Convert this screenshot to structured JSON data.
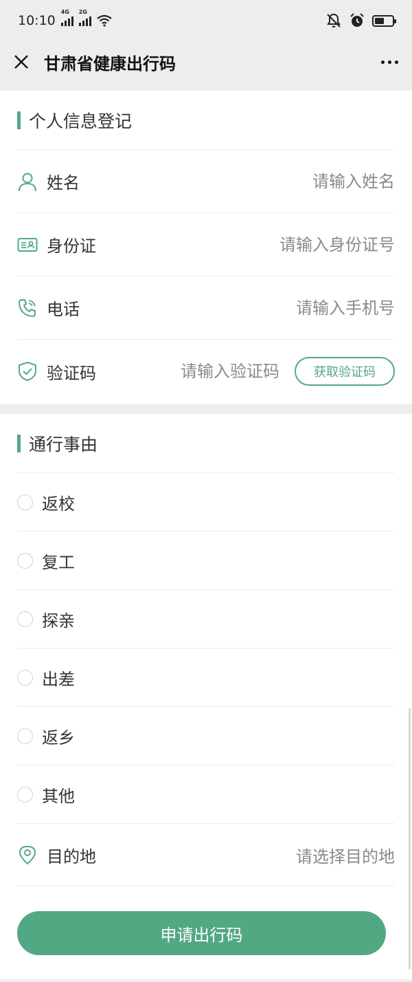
{
  "status_bar": {
    "time": "10:10",
    "net1": "4G",
    "net2": "2G"
  },
  "title_bar": {
    "title": "甘肃省健康出行码"
  },
  "personal_info": {
    "section_title": "个人信息登记",
    "name": {
      "label": "姓名",
      "placeholder": "请输入姓名"
    },
    "id_card": {
      "label": "身份证",
      "placeholder": "请输入身份证号"
    },
    "phone": {
      "label": "电话",
      "placeholder": "请输入手机号"
    },
    "code": {
      "label": "验证码",
      "placeholder": "请输入验证码",
      "button": "获取验证码"
    }
  },
  "travel": {
    "section_title": "通行事由",
    "reasons": [
      "返校",
      "复工",
      "探亲",
      "出差",
      "返乡",
      "其他"
    ],
    "destination": {
      "label": "目的地",
      "placeholder": "请选择目的地"
    }
  },
  "submit_label": "申请出行码",
  "colors": {
    "accent": "#53a884",
    "background": "#ededed"
  },
  "status_icons": [
    "signal-icon",
    "wifi-icon",
    "mute-icon",
    "alarm-icon",
    "battery-icon"
  ],
  "battery_level": 0.55
}
